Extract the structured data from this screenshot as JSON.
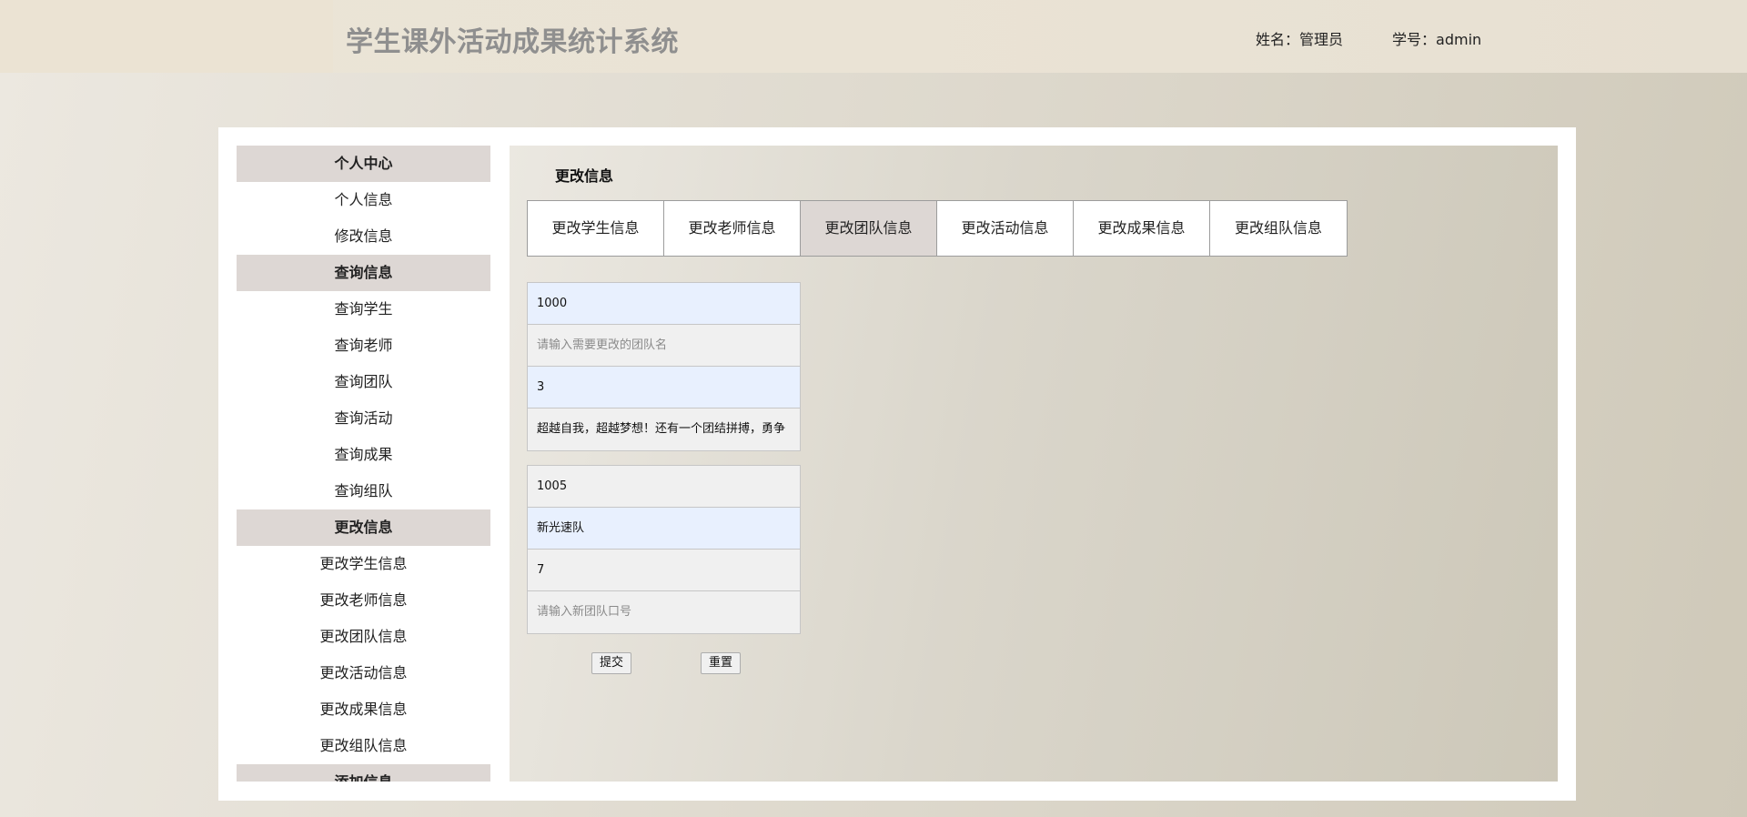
{
  "header": {
    "title": "学生课外活动成果统计系统",
    "name_label": "姓名：",
    "name_value": "管理员",
    "id_label": "学号：",
    "id_value": "admin"
  },
  "sidebar": {
    "items": [
      {
        "label": "个人中心",
        "group": true
      },
      {
        "label": "个人信息",
        "group": false
      },
      {
        "label": "修改信息",
        "group": false
      },
      {
        "label": "查询信息",
        "group": true
      },
      {
        "label": "查询学生",
        "group": false
      },
      {
        "label": "查询老师",
        "group": false
      },
      {
        "label": "查询团队",
        "group": false
      },
      {
        "label": "查询活动",
        "group": false
      },
      {
        "label": "查询成果",
        "group": false
      },
      {
        "label": "查询组队",
        "group": false
      },
      {
        "label": "更改信息",
        "group": true
      },
      {
        "label": "更改学生信息",
        "group": false
      },
      {
        "label": "更改老师信息",
        "group": false
      },
      {
        "label": "更改团队信息",
        "group": false
      },
      {
        "label": "更改活动信息",
        "group": false
      },
      {
        "label": "更改成果信息",
        "group": false
      },
      {
        "label": "更改组队信息",
        "group": false
      },
      {
        "label": "添加信息",
        "group": true
      }
    ]
  },
  "main": {
    "title": "更改信息",
    "tabs": [
      {
        "label": "更改学生信息",
        "active": false
      },
      {
        "label": "更改老师信息",
        "active": false
      },
      {
        "label": "更改团队信息",
        "active": true
      },
      {
        "label": "更改活动信息",
        "active": false
      },
      {
        "label": "更改成果信息",
        "active": false
      },
      {
        "label": "更改组队信息",
        "active": false
      }
    ],
    "form1": {
      "team_id": "1000",
      "team_name_placeholder": "请输入需要更改的团队名",
      "member_count": "3",
      "slogan": "超越自我，超越梦想！还有一个团结拼搏，勇争"
    },
    "form2": {
      "team_id": "1005",
      "team_name": "新光速队",
      "member_count": "7",
      "slogan_placeholder": "请输入新团队口号"
    },
    "submit_label": "提交",
    "reset_label": "重置"
  }
}
